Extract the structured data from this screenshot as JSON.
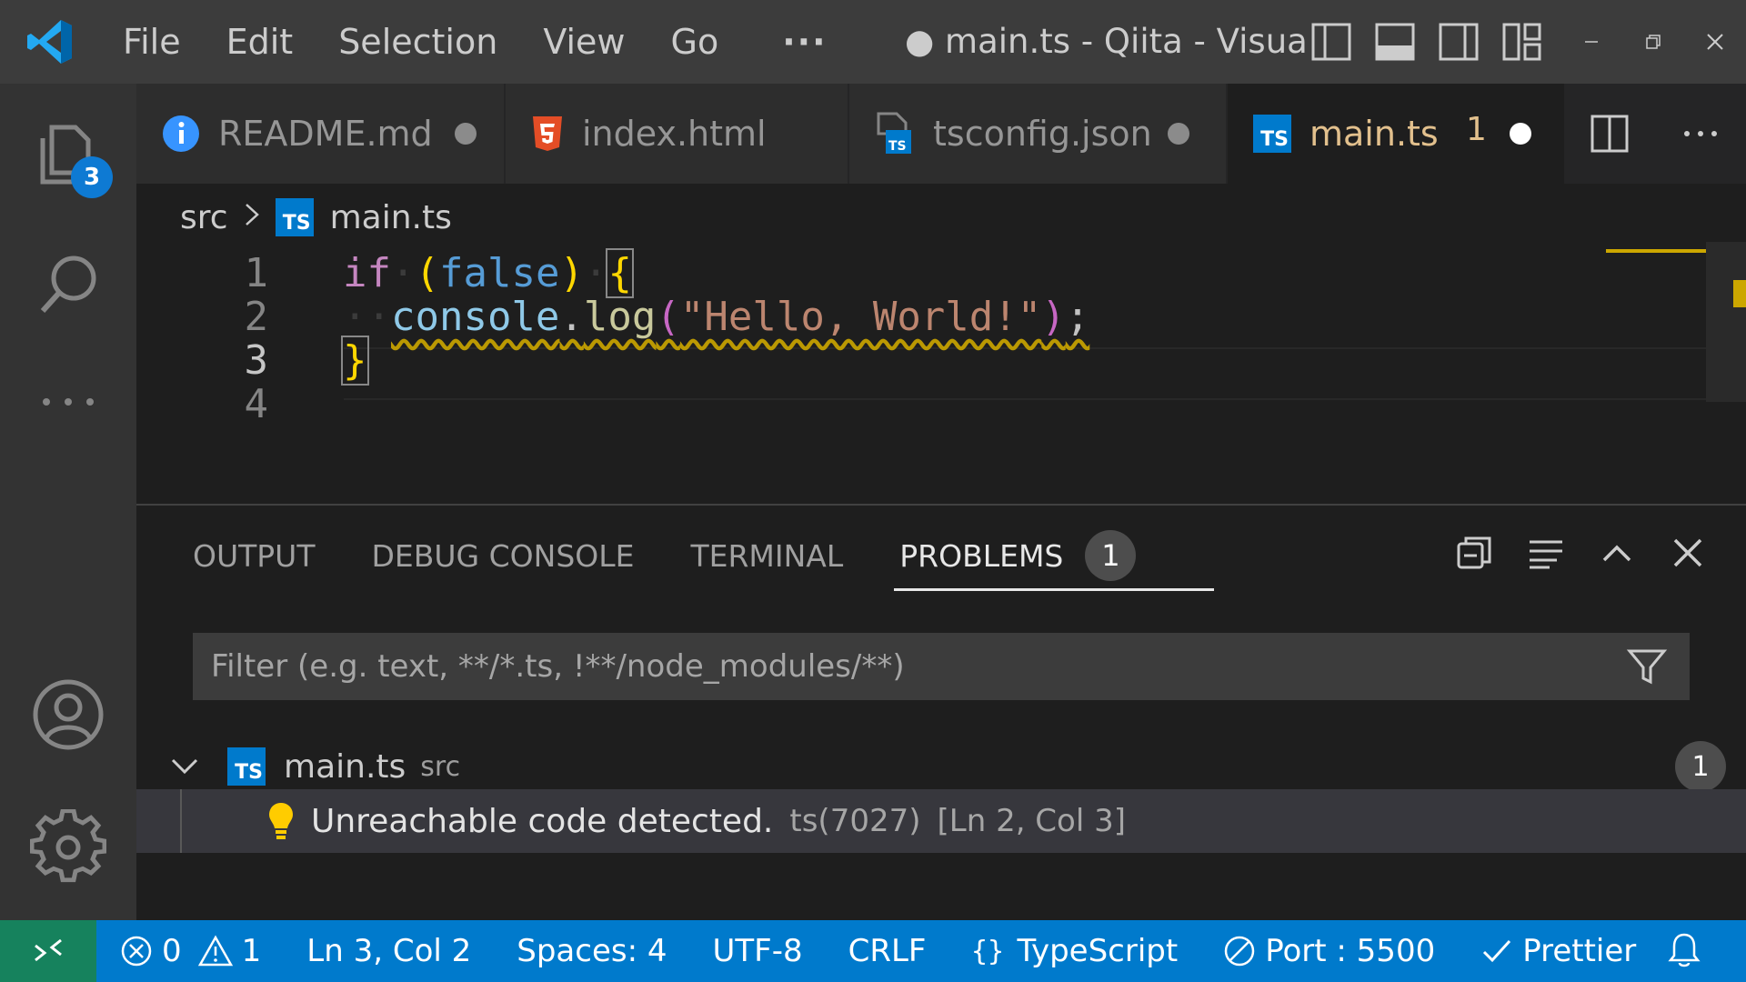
{
  "menu": {
    "items": [
      "File",
      "Edit",
      "Selection",
      "View",
      "Go"
    ],
    "more": "···"
  },
  "window": {
    "title": "● main.ts - Qiita - Visual ..."
  },
  "activity": {
    "explorer_badge": "3"
  },
  "tabs": [
    {
      "label": "README.md",
      "icon": "info-icon",
      "dirty": true
    },
    {
      "label": "index.html",
      "icon": "html5-icon",
      "dirty": false
    },
    {
      "label": "tsconfig.json",
      "icon": "tsconfig-icon",
      "dirty": true
    },
    {
      "label": "main.ts",
      "icon": "typescript-icon",
      "dirty": true,
      "errors": "1",
      "active": true
    }
  ],
  "breadcrumb": {
    "folder": "src",
    "file": "main.ts"
  },
  "editor": {
    "line_numbers": [
      "1",
      "2",
      "3",
      "4"
    ],
    "code": {
      "l1_kw": "if",
      "l1_bool": "false",
      "l2_obj": "console",
      "l2_fn": "log",
      "l2_str": "\"Hello, World!\"",
      "l3_brace": "}"
    }
  },
  "panel": {
    "tabs": [
      "OUTPUT",
      "DEBUG CONSOLE",
      "TERMINAL",
      "PROBLEMS"
    ],
    "problems_count": "1",
    "filter_placeholder": "Filter (e.g. text, **/*.ts, !**/node_modules/**)",
    "file": {
      "name": "main.ts",
      "dir": "src",
      "count": "1"
    },
    "problem": {
      "message": "Unreachable code detected.",
      "code": "ts(7027)",
      "position": "[Ln 2, Col 3]"
    }
  },
  "status": {
    "errors": "0",
    "warnings": "1",
    "position": "Ln 3, Col 2",
    "spaces": "Spaces: 4",
    "encoding": "UTF-8",
    "eol": "CRLF",
    "language": "TypeScript",
    "port": "Port : 5500",
    "prettier": "Prettier"
  },
  "colors": {
    "accent": "#007acc",
    "remote": "#16825d",
    "modified_tab": "#e2c08d",
    "warning": "#cca700"
  }
}
